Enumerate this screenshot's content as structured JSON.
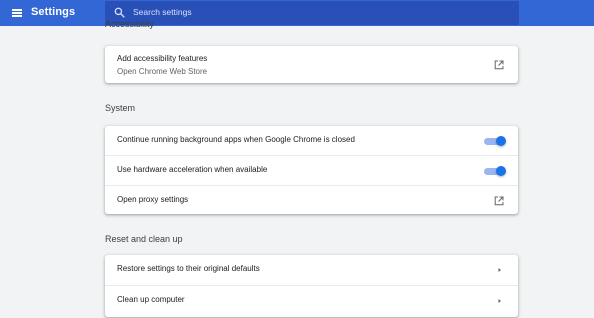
{
  "header": {
    "title": "Settings",
    "search_placeholder": "Search settings"
  },
  "accessibility": {
    "section_title": "Accessibility",
    "items": [
      {
        "label": "Add accessibility features",
        "sublabel": "Open Chrome Web Store"
      }
    ]
  },
  "system": {
    "section_title": "System",
    "items": [
      {
        "label": "Continue running background apps when Google Chrome is closed",
        "enabled": true
      },
      {
        "label": "Use hardware acceleration when available",
        "enabled": true
      },
      {
        "label": "Open proxy settings"
      }
    ]
  },
  "reset": {
    "section_title": "Reset and clean up",
    "items": [
      {
        "label": "Restore settings to their original defaults"
      },
      {
        "label": "Clean up computer"
      }
    ]
  },
  "colors": {
    "toolbar": "#3367d6",
    "toggle_on": "#1a73e8"
  }
}
